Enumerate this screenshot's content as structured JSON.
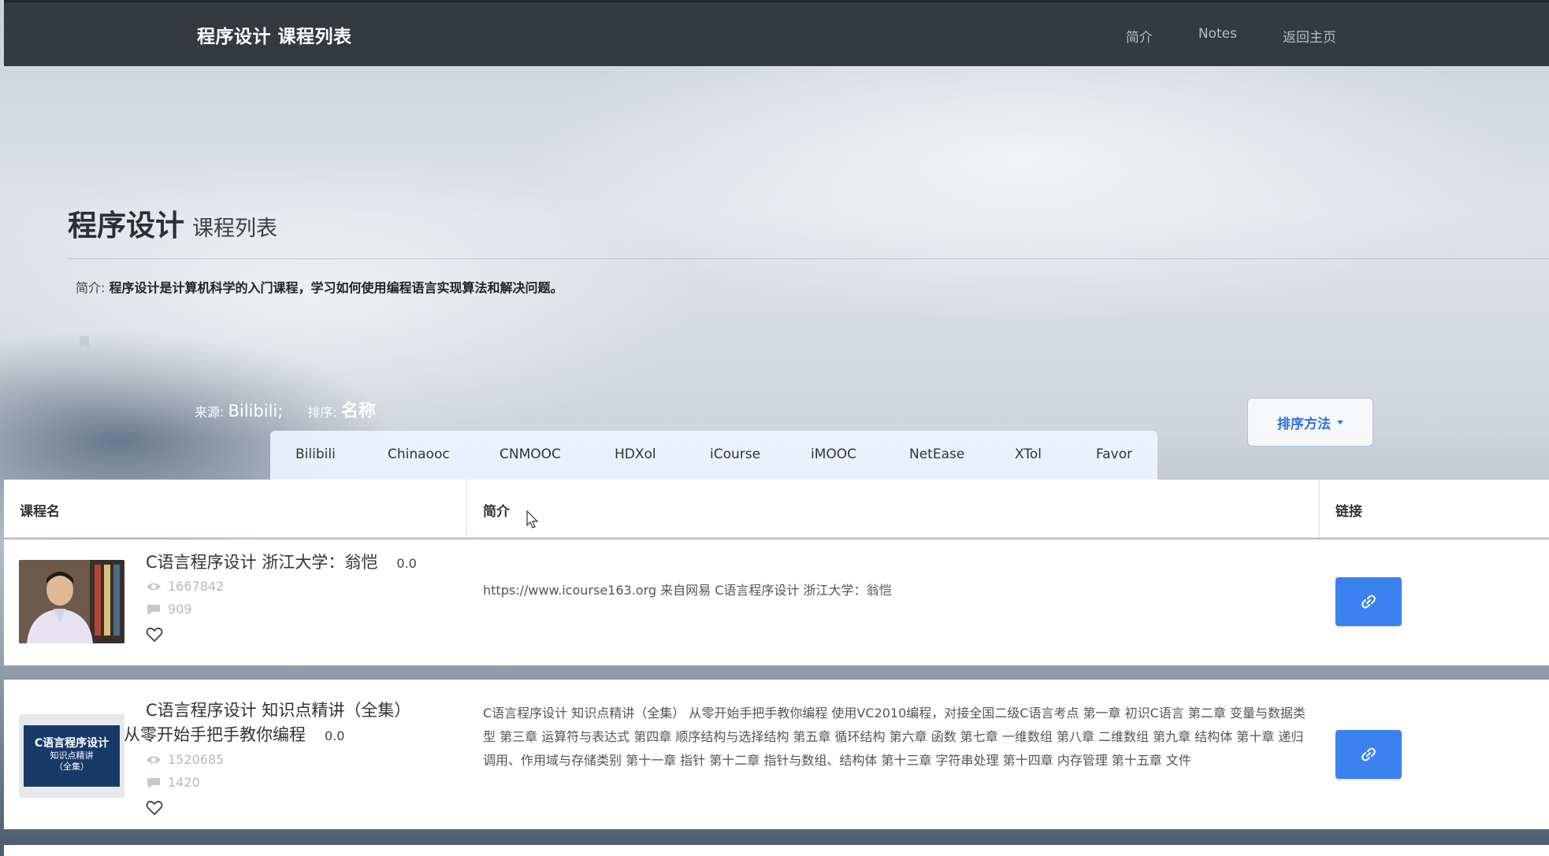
{
  "navbar": {
    "brand": "程序设计 课程列表",
    "links": [
      "简介",
      "Notes",
      "返回主页"
    ]
  },
  "hero": {
    "title": "程序设计",
    "subtitle": "课程列表",
    "intro_label": "简介:",
    "intro_text": "程序设计是计算机科学的入门课程，学习如何使用编程语言实现算法和解决问题。",
    "source_label": "来源:",
    "source_value": "Bilibili;",
    "sort_label": "排序:",
    "sort_value": "名称",
    "sort_button": "排序方法"
  },
  "tabs": [
    "Bilibili",
    "Chinaooc",
    "CNMOOC",
    "HDXol",
    "iCourse",
    "iMOOC",
    "NetEase",
    "XTol",
    "Favor"
  ],
  "table": {
    "headers": [
      "课程名",
      "简介",
      "链接"
    ],
    "rows": [
      {
        "title_line1": "C语言程序设计 浙江大学：翁恺",
        "title_line2": "",
        "rating": "0.0",
        "views": "1667842",
        "comments": "909",
        "description": "https://www.icourse163.org 来自网易 C语言程序设计 浙江大学：翁恺"
      },
      {
        "title_line1": "C语言程序设计 知识点精讲（全集）",
        "title_line2": "从零开始手把手教你编程",
        "rating": "0.0",
        "views": "1520685",
        "comments": "1420",
        "thumb_text": [
          "C语言程序设计",
          "知识点精讲",
          "（全集）"
        ],
        "description": "C语言程序设计 知识点精讲（全集） 从零开始手把手教你编程 使用VC2010编程，对接全国二级C语言考点 第一章 初识C语言 第二章 变量与数据类型 第三章 运算符与表达式 第四章 顺序结构与选择结构 第五章 循环结构 第六章 函数 第七章 一维数组 第八章 二维数组 第九章 结构体 第十章 递归调用、作用域与存储类别 第十一章 指针 第十二章 指针与数组、结构体 第十三章 字符串处理 第十四章 内存管理 第十五章 文件"
      }
    ]
  },
  "colors": {
    "navbar": "#343a40",
    "accent": "#3b82f0",
    "tabs_bg": "#edf3ff"
  }
}
